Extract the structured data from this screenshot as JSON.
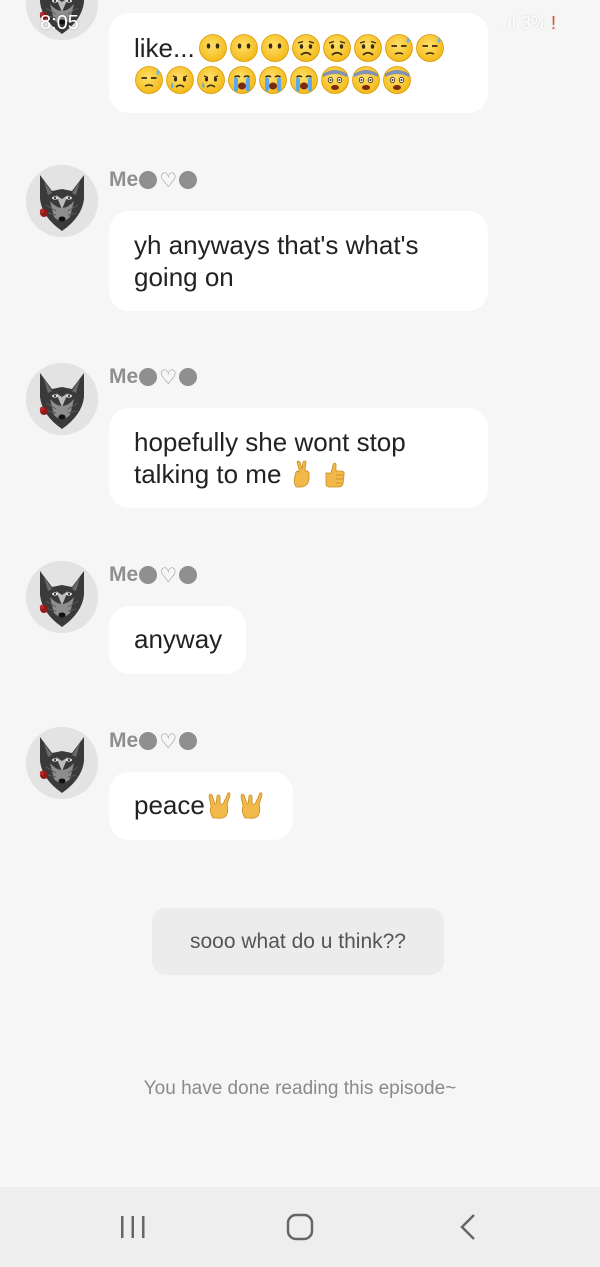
{
  "status_bar": {
    "time": "8:05",
    "battery": "3%",
    "warn": "!"
  },
  "messages": [
    {
      "text": "like..."
    },
    {
      "sender": "Me",
      "text_line1": "yh anyways that's what's",
      "text_line2": "going on"
    },
    {
      "sender": "Me",
      "text_line1": "hopefully she wont stop",
      "text_line2": "talking to me"
    },
    {
      "sender": "Me",
      "text": "anyway"
    },
    {
      "sender": "Me",
      "text": "peace"
    }
  ],
  "poll": {
    "question": "sooo what do u think??"
  },
  "footer": {
    "end_text": "You have done reading this episode~"
  },
  "nav": {
    "recents_icon": "recent-apps-icon",
    "home_icon": "home-icon",
    "back_icon": "back-icon"
  },
  "colors": {
    "background": "#f6f6f6",
    "bubble": "#ffffff",
    "sender": "#8f8f8f",
    "emoji": "#f6c21c",
    "warn": "#f04a2a"
  }
}
